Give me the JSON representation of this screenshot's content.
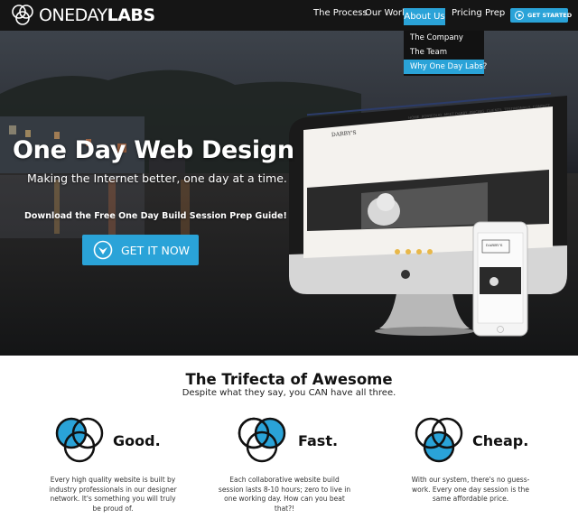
{
  "nav": {
    "logo": {
      "part1": "ONEDAY",
      "part2": "LABS",
      "icon": "venn-logo-icon"
    },
    "items": [
      "The Process",
      "Our Work",
      "About Us",
      "Pricing",
      "Prep"
    ],
    "active": "About Us",
    "cta": "GET STARTED",
    "dropdown": [
      "The Company",
      "The Team",
      "Why One Day Labs?"
    ],
    "dropdown_selected": "Why One Day Labs?"
  },
  "hero": {
    "title": "One Day Web Design",
    "subtitle": "Making the Internet better, one day at a time.",
    "download_text": "Download the Free One Day Build Session Prep Guide!",
    "button": "GET IT NOW",
    "mockup": {
      "brand": "DARBY'S",
      "nav": [
        "HOME",
        "PORTFOLIO",
        "MEET DARBY",
        "PRICING",
        "CLIENTS",
        "TESTIMONIALS",
        "CONTACT"
      ]
    }
  },
  "trifecta": {
    "title": "The Trifecta of Awesome",
    "subtitle": "Despite what they say, you CAN have all three.",
    "features": [
      {
        "label": "Good.",
        "desc": "Every high quality website is built by industry professionals in our designer network. It's something you will truly be proud of."
      },
      {
        "label": "Fast.",
        "desc": "Each collaborative website build session lasts 8-10 hours; zero to live in one working day. How can you beat that?!"
      },
      {
        "label": "Cheap.",
        "desc": "With our system, there's no guess-work. Every one day session is the same affordable price."
      }
    ]
  },
  "colors": {
    "accent": "#2aa3d8",
    "nav_bg": "#151515",
    "venn_fill": "#2aa3d8"
  }
}
